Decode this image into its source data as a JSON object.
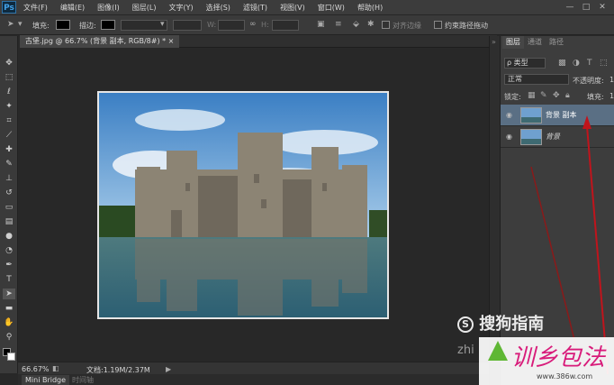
{
  "app": {
    "logo": "Ps"
  },
  "menu": [
    "文件(F)",
    "编辑(E)",
    "图像(I)",
    "图层(L)",
    "文字(Y)",
    "选择(S)",
    "滤镜(T)",
    "视图(V)",
    "窗口(W)",
    "帮助(H)"
  ],
  "window_controls": [
    "—",
    "□",
    "✕"
  ],
  "options": {
    "fill_label": "填充:",
    "stroke_label": "描边:",
    "w_label": "W:",
    "h_label": "H:",
    "align_edges_label": "对齐边缘",
    "constrain_label": "约束路径拖动"
  },
  "document": {
    "tab_title": "古堡.jpg @ 66.7% (背景 副本, RGB/8#) *  ×"
  },
  "status": {
    "zoom": "66.67%",
    "doc_info": "文档:1.19M/2.37M"
  },
  "bottom_tabs": [
    "Mini Bridge",
    "时间轴"
  ],
  "layers_panel": {
    "tabs": [
      "图层",
      "通道",
      "路径"
    ],
    "filter_kind": "ρ 类型",
    "blend_mode": "正常",
    "opacity_label": "不透明度:",
    "opacity_value": "10",
    "lock_label": "锁定:",
    "fill_label": "填充:",
    "fill_value": "10",
    "layers": [
      {
        "name": "背景 副本",
        "selected": true
      },
      {
        "name": "背景",
        "selected": false
      }
    ]
  },
  "watermarks": {
    "sogou": "搜狗指南",
    "zhi": "zhi",
    "site_logo": "训乡包法",
    "site_url": "www.386w.com"
  },
  "colors": {
    "accent_selected": "#5a6f84",
    "arrow": "#c0141c"
  }
}
